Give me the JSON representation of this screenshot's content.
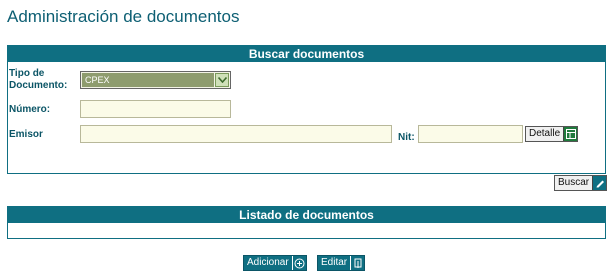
{
  "page": {
    "title": "Administración de documentos"
  },
  "search_panel": {
    "header": "Buscar documentos",
    "tipo_label_line1": "Tipo de",
    "tipo_label_line2": "Documento:",
    "tipo_selected": "CPEX",
    "numero_label": "Número:",
    "numero_value": "",
    "emisor_label": "Emisor",
    "emisor_value": "",
    "nit_label": "Nit:",
    "nit_value": "",
    "detalle_button": "Detalle",
    "buscar_button": "Buscar"
  },
  "list_panel": {
    "header": "Listado de documentos"
  },
  "actions": {
    "adicionar_button": "Adicionar",
    "editar_button": "Editar"
  },
  "icons": {
    "detalle": "grid-icon",
    "buscar": "pencil-icon",
    "adicionar": "plus-circle-icon",
    "editar": "edit-icon",
    "select": "chevron-down-icon"
  },
  "colors": {
    "accent": "#0f6f82",
    "field_bg": "#fbfbe8",
    "select_value_bg": "#8e9c6e"
  }
}
